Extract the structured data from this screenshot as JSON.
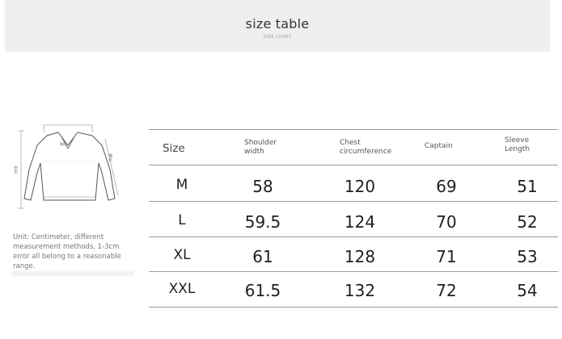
{
  "header": {
    "title": "size table",
    "subtitle": "SIZE CHART"
  },
  "diagram": {
    "label_left": "衣长",
    "label_top": "胸围",
    "label_right": "袖长"
  },
  "note": "Unit: Centimeter, different measurement methods, 1-3cm error all belong to a reasonable range.",
  "table": {
    "columns": [
      "Size",
      "Shoulder width",
      "Chest circumference",
      "Captain",
      "Sleeve Length"
    ],
    "col_header_lines": [
      [
        "Size"
      ],
      [
        "Shoulder",
        "width"
      ],
      [
        "Chest",
        "circumference"
      ],
      [
        "Captain"
      ],
      [
        "Sleeve",
        "Length"
      ]
    ],
    "rows": [
      {
        "size": "M",
        "shoulder": "58",
        "chest": "120",
        "captain": "69",
        "sleeve": "51"
      },
      {
        "size": "L",
        "shoulder": "59.5",
        "chest": "124",
        "captain": "70",
        "sleeve": "52"
      },
      {
        "size": "XL",
        "shoulder": "61",
        "chest": "128",
        "captain": "71",
        "sleeve": "53"
      },
      {
        "size": "XXL",
        "shoulder": "61.5",
        "chest": "132",
        "captain": "72",
        "sleeve": "54"
      }
    ]
  }
}
